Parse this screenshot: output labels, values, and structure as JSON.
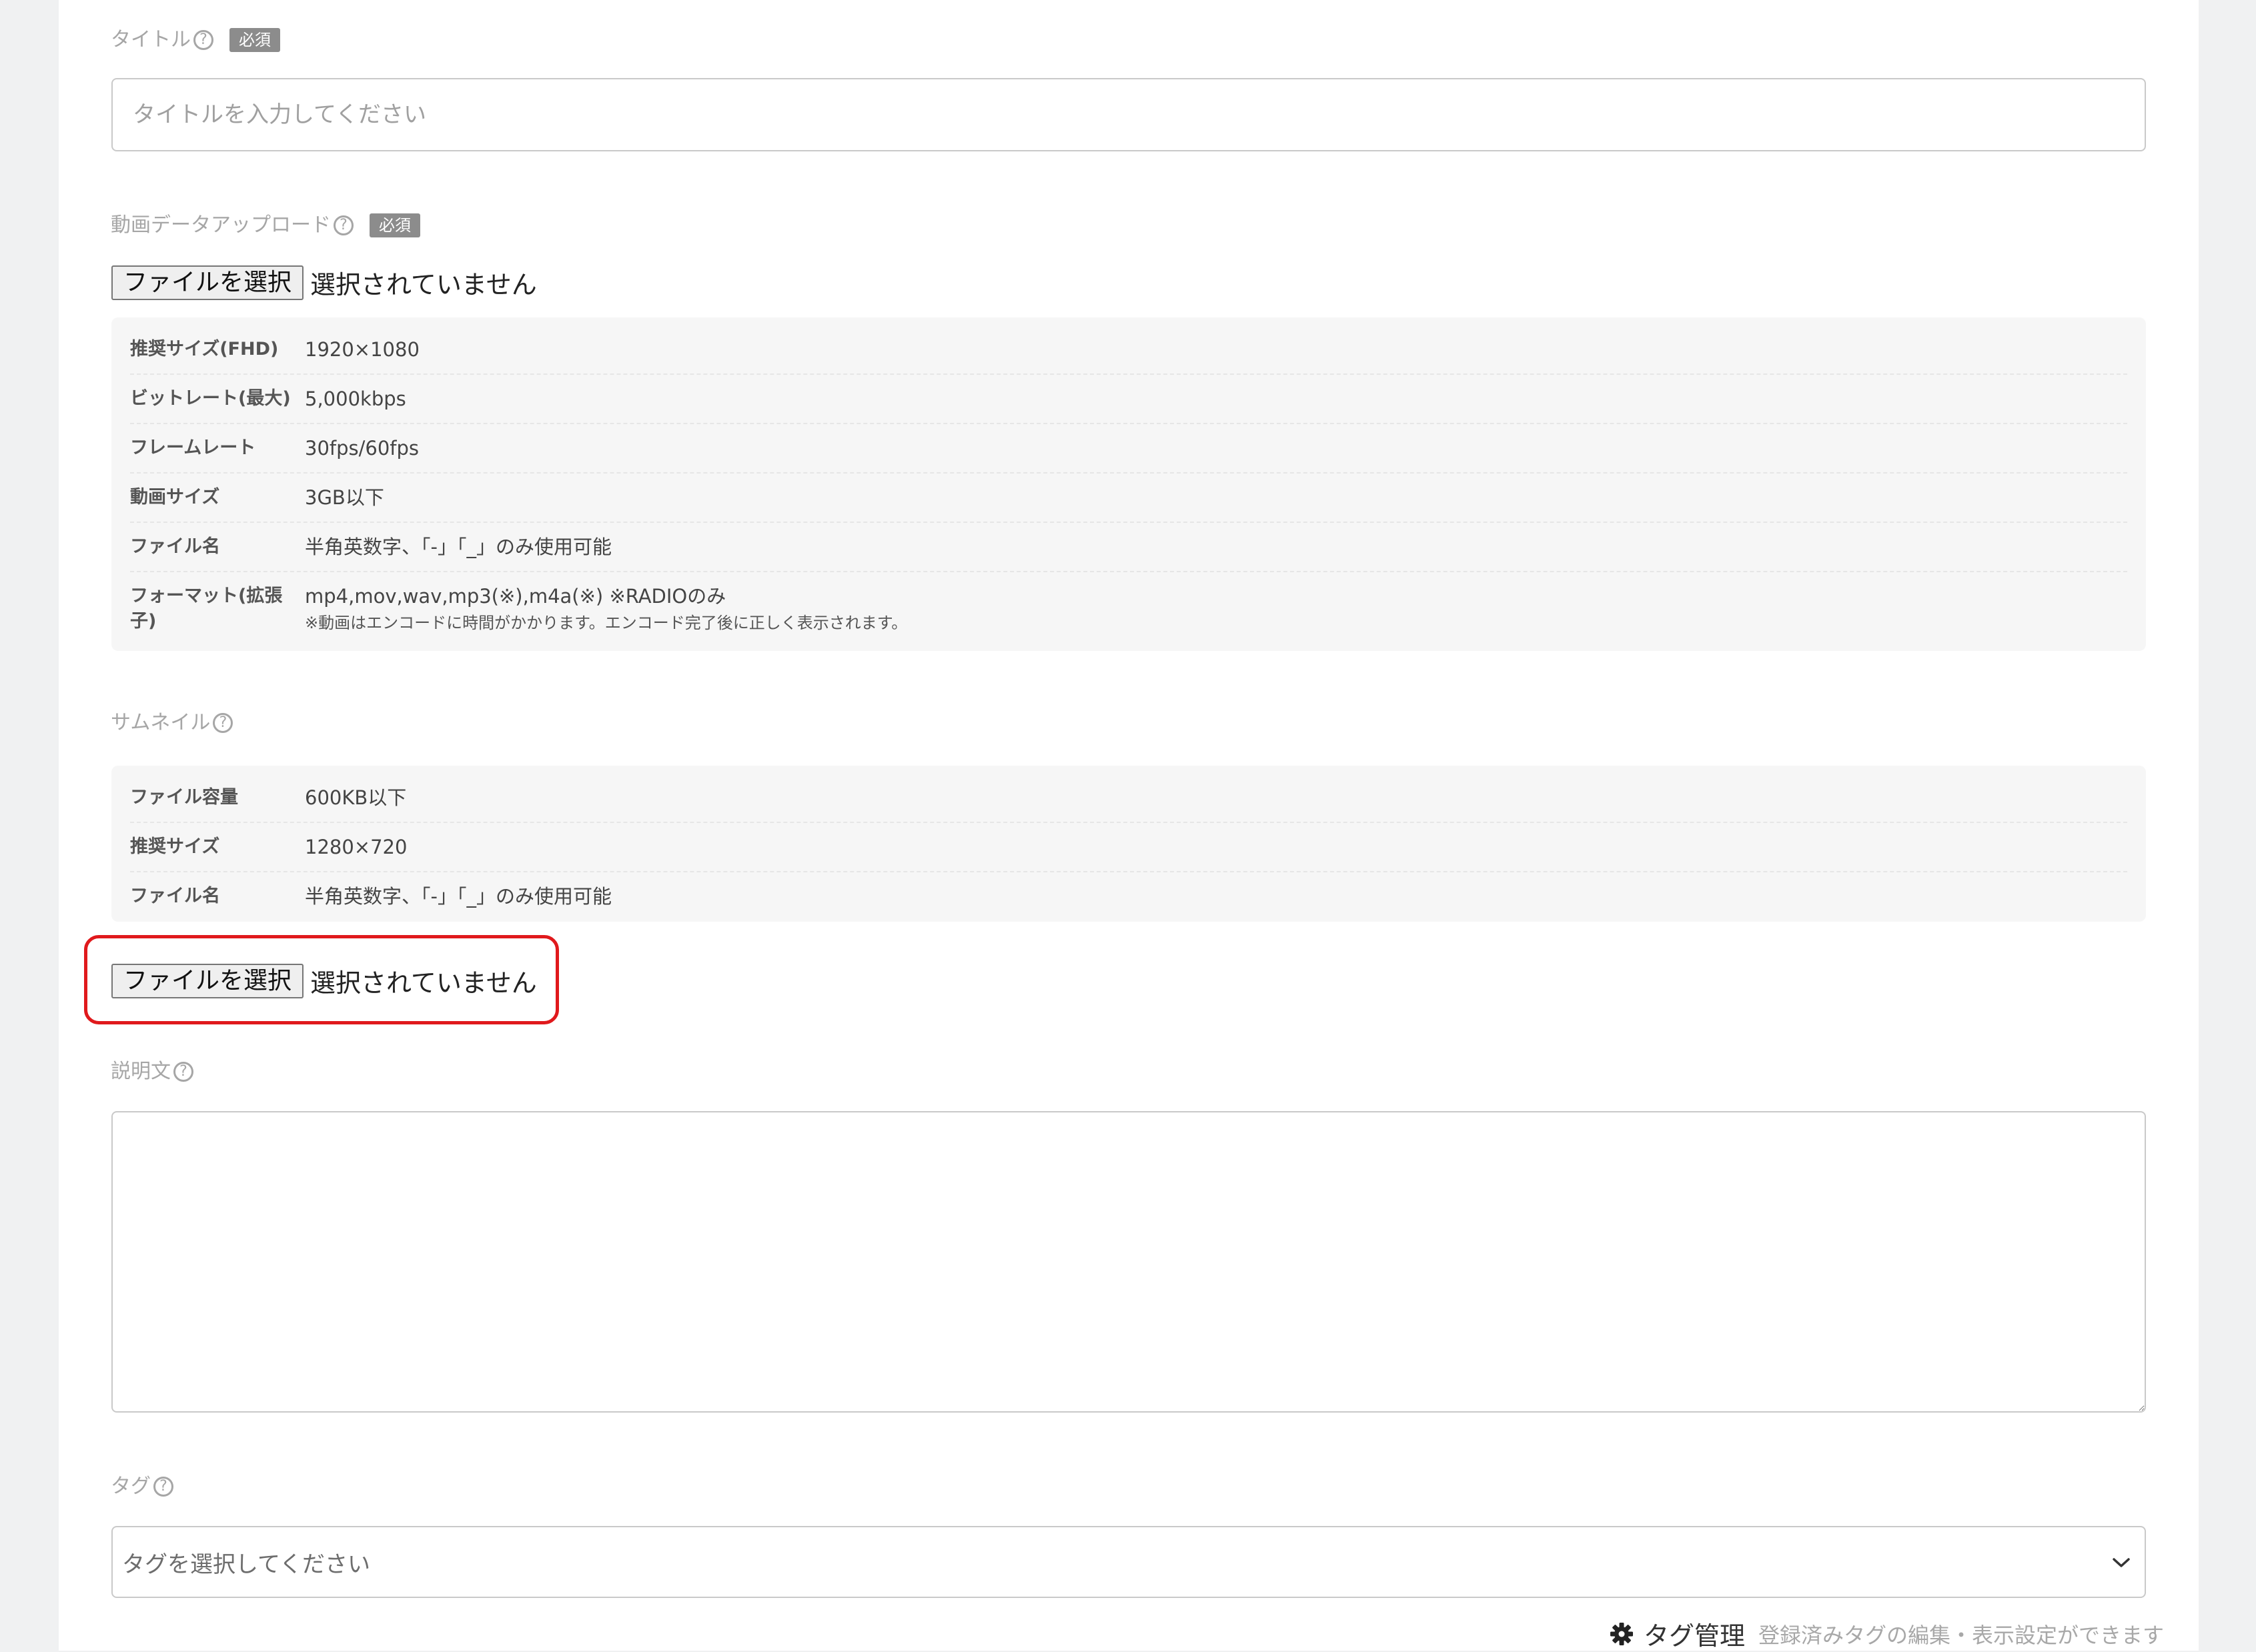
{
  "title_field": {
    "label": "タイトル",
    "help": "?",
    "required_badge": "必須",
    "placeholder": "タイトルを入力してください"
  },
  "video_field": {
    "label": "動画データアップロード",
    "help": "?",
    "required_badge": "必須",
    "file_button": "ファイルを選択",
    "file_status": "選択されていません",
    "specs": [
      {
        "key": "推奨サイズ(FHD)",
        "value": "1920×1080"
      },
      {
        "key": "ビットレート(最大)",
        "value": "5,000kbps"
      },
      {
        "key": "フレームレート",
        "value": "30fps/60fps"
      },
      {
        "key": "動画サイズ",
        "value": "3GB以下"
      },
      {
        "key": "ファイル名",
        "value": "半角英数字、「-」「_」のみ使用可能"
      },
      {
        "key": "フォーマット(拡張子)",
        "value": "mp4,mov,wav,mp3(※),m4a(※) ※RADIOのみ",
        "note": "※動画はエンコードに時間がかかります。エンコード完了後に正しく表示されます。"
      }
    ]
  },
  "thumbnail_field": {
    "label": "サムネイル",
    "help": "?",
    "specs": [
      {
        "key": "ファイル容量",
        "value": "600KB以下"
      },
      {
        "key": "推奨サイズ",
        "value": "1280×720"
      },
      {
        "key": "ファイル名",
        "value": "半角英数字、「-」「_」のみ使用可能"
      }
    ],
    "file_button": "ファイルを選択",
    "file_status": "選択されていません",
    "highlight_color": "#e0191c"
  },
  "description_field": {
    "label": "説明文",
    "help": "?"
  },
  "tag_field": {
    "label": "タグ",
    "help": "?",
    "placeholder": "タグを選択してください",
    "chevron_icon": "chevron-down-icon",
    "manage_icon": "gear-icon",
    "manage_label": "タグ管理",
    "manage_desc": "登録済みタグの編集・表示設定ができます"
  }
}
